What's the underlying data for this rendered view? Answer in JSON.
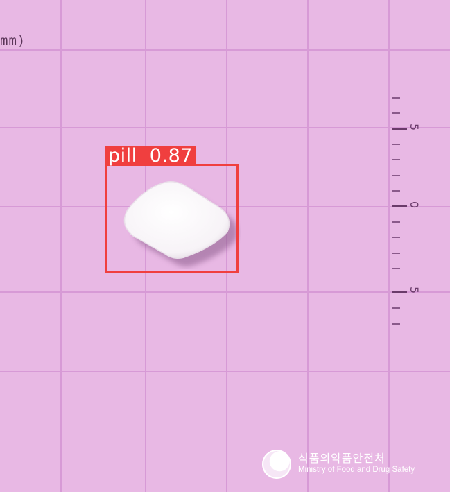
{
  "scale": {
    "unit_label": "mm)",
    "ruler_labels": [
      "5",
      "0",
      "5"
    ]
  },
  "detection": {
    "label": "pill  0.87",
    "class": "pill",
    "confidence": 0.87,
    "box_color": "#f03f3f"
  },
  "watermark": {
    "korean": "식품의약품안전처",
    "english": "Ministry of Food and Drug Safety"
  },
  "colors": {
    "background": "#e8b8e4",
    "grid": "#d79ad6",
    "pill": "#ffffff"
  }
}
